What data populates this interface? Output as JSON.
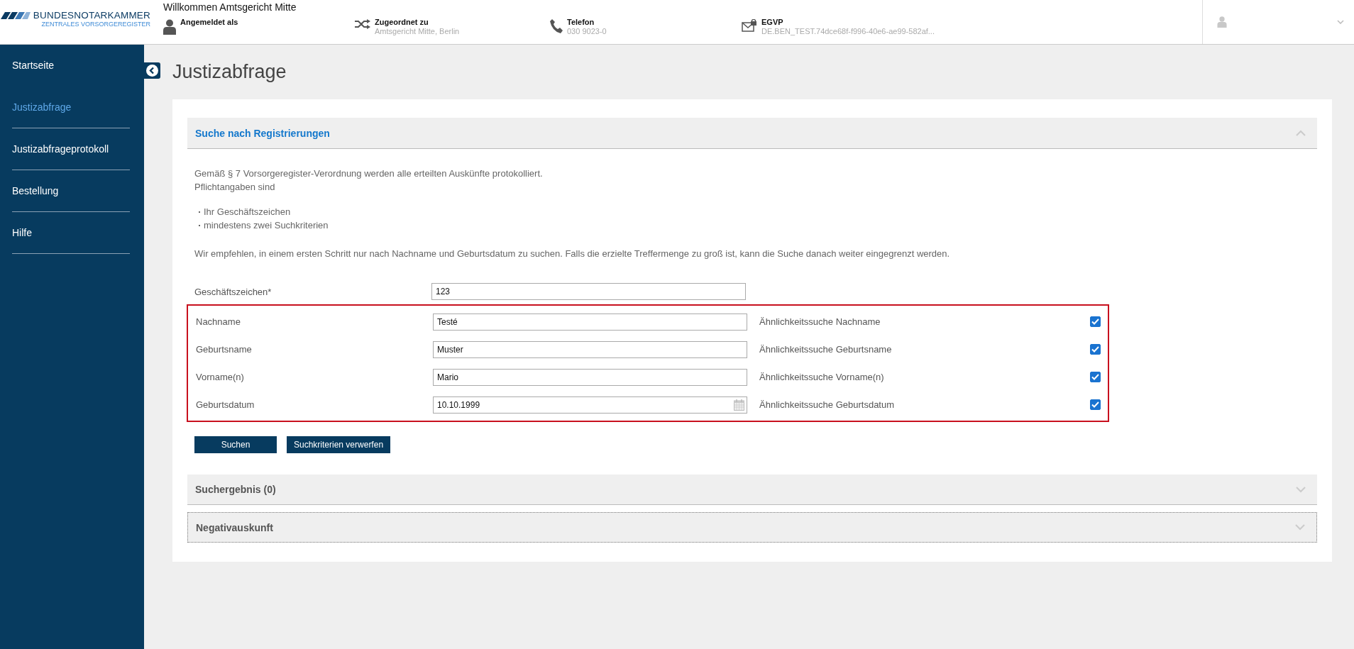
{
  "header": {
    "logo": {
      "name": "BUNDESNOTARKAMMER",
      "subtitle": "ZENTRALES VORSORGEREGISTER"
    },
    "welcome": "Willkommen Amtsgericht Mitte",
    "info": [
      {
        "kind": "user",
        "label": "Angemeldet als"
      },
      {
        "kind": "assigned",
        "label": "Zugeordnet zu",
        "value": "Amtsgericht Mitte, Berlin"
      },
      {
        "kind": "phone",
        "label": "Telefon",
        "value": "030 9023-0"
      },
      {
        "kind": "mail",
        "label": "EGVP",
        "value": "DE.BEN_TEST.74dce68f-f996-40e6-ae99-582af..."
      }
    ]
  },
  "sidebar": {
    "items": [
      {
        "label": "Startseite",
        "selected": false
      },
      {
        "label": "Justizabfrage",
        "selected": true
      },
      {
        "label": "Justizabfrageprotokoll",
        "selected": false
      },
      {
        "label": "Bestellung",
        "selected": false
      },
      {
        "label": "Hilfe",
        "selected": false
      }
    ]
  },
  "page_title": "Justizabfrage",
  "search_panel": {
    "title": "Suche nach Registrierungen",
    "expanded": true,
    "intro": [
      "Gemäß § 7 Vorsorgeregister-Verordnung werden alle erteilten Auskünfte protokolliert.",
      "Pflichtangaben sind"
    ],
    "bullets": [
      "Ihr Geschäftszeichen",
      "mindestens zwei Suchkriterien"
    ],
    "hint": "Wir empfehlen, in einem ersten Schritt nur nach Nachname und Geburtsdatum zu suchen. Falls die erzielte Treffermenge zu groß ist, kann die Suche danach weiter eingegrenzt werden.",
    "reference": {
      "label": "Geschäftszeichen*",
      "value": "123"
    },
    "criteria": {
      "highlighted": true,
      "rows": [
        {
          "label": "Nachname",
          "value": "Testé",
          "kind": "text",
          "similarity": {
            "label": "Ähnlichkeitssuche Nachname",
            "checked": true
          }
        },
        {
          "label": "Geburtsname",
          "value": "Muster",
          "kind": "text",
          "similarity": {
            "label": "Ähnlichkeitssuche Geburtsname",
            "checked": true
          }
        },
        {
          "label": "Vorname(n)",
          "value": "Mario",
          "kind": "text",
          "similarity": {
            "label": "Ähnlichkeitssuche Vorname(n)",
            "checked": true
          }
        },
        {
          "label": "Geburtsdatum",
          "value": "10.10.1999",
          "kind": "date",
          "similarity": {
            "label": "Ähnlichkeitssuche Geburtsdatum",
            "checked": true
          }
        }
      ]
    },
    "buttons": [
      "Suchen",
      "Suchkriterien verwerfen"
    ]
  },
  "panels": [
    {
      "title": "Suchergebnis (0)",
      "expanded": false
    },
    {
      "title": "Negativauskunft",
      "expanded": false
    }
  ]
}
